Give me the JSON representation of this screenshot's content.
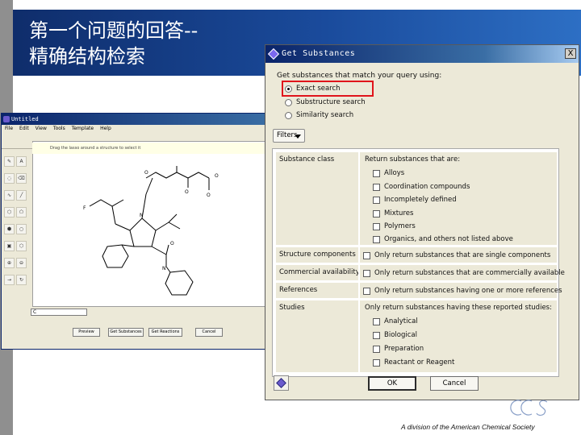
{
  "slide": {
    "title_line1": "第一个问题的回答--",
    "title_line2": "精确结构检索",
    "header_color": "#1a4b9c",
    "footer_text": "A division of the American Chemical Society",
    "logo_text": "CAS"
  },
  "editor": {
    "window_title": "Untitled",
    "menu": [
      "File",
      "Edit",
      "View",
      "Tools",
      "Template",
      "Help"
    ],
    "hint": "Drag the lasso around a structure to select it",
    "buttons": {
      "preview": "Preview",
      "get_substances": "Get Substances",
      "get_reactions": "Get Reactions",
      "cancel": "Cancel"
    }
  },
  "dialog": {
    "title": "Get Substances",
    "close_label": "X",
    "match_label": "Get substances that match your query using:",
    "search_options": [
      {
        "label": "Exact search",
        "selected": true
      },
      {
        "label": "Substructure search",
        "selected": false
      },
      {
        "label": "Similarity search",
        "selected": false
      }
    ],
    "filters_label": "Filters",
    "filters": {
      "substance_class": {
        "name": "Substance class",
        "heading": "Return substances that are:",
        "options": [
          "Alloys",
          "Coordination compounds",
          "Incompletely defined",
          "Mixtures",
          "Polymers",
          "Organics, and others not listed above"
        ]
      },
      "structure_components": {
        "name": "Structure components",
        "option": "Only return substances that are single components"
      },
      "commercial_availability": {
        "name": "Commercial availability",
        "option": "Only return substances that are commercially available"
      },
      "references": {
        "name": "References",
        "option": "Only return substances having one or more references"
      },
      "studies": {
        "name": "Studies",
        "heading": "Only return substances having these reported studies:",
        "options": [
          "Analytical",
          "Biological",
          "Preparation",
          "Reactant or Reagent"
        ]
      }
    },
    "ok_label": "OK",
    "cancel_label": "Cancel",
    "highlight_color": "#e0141b"
  }
}
